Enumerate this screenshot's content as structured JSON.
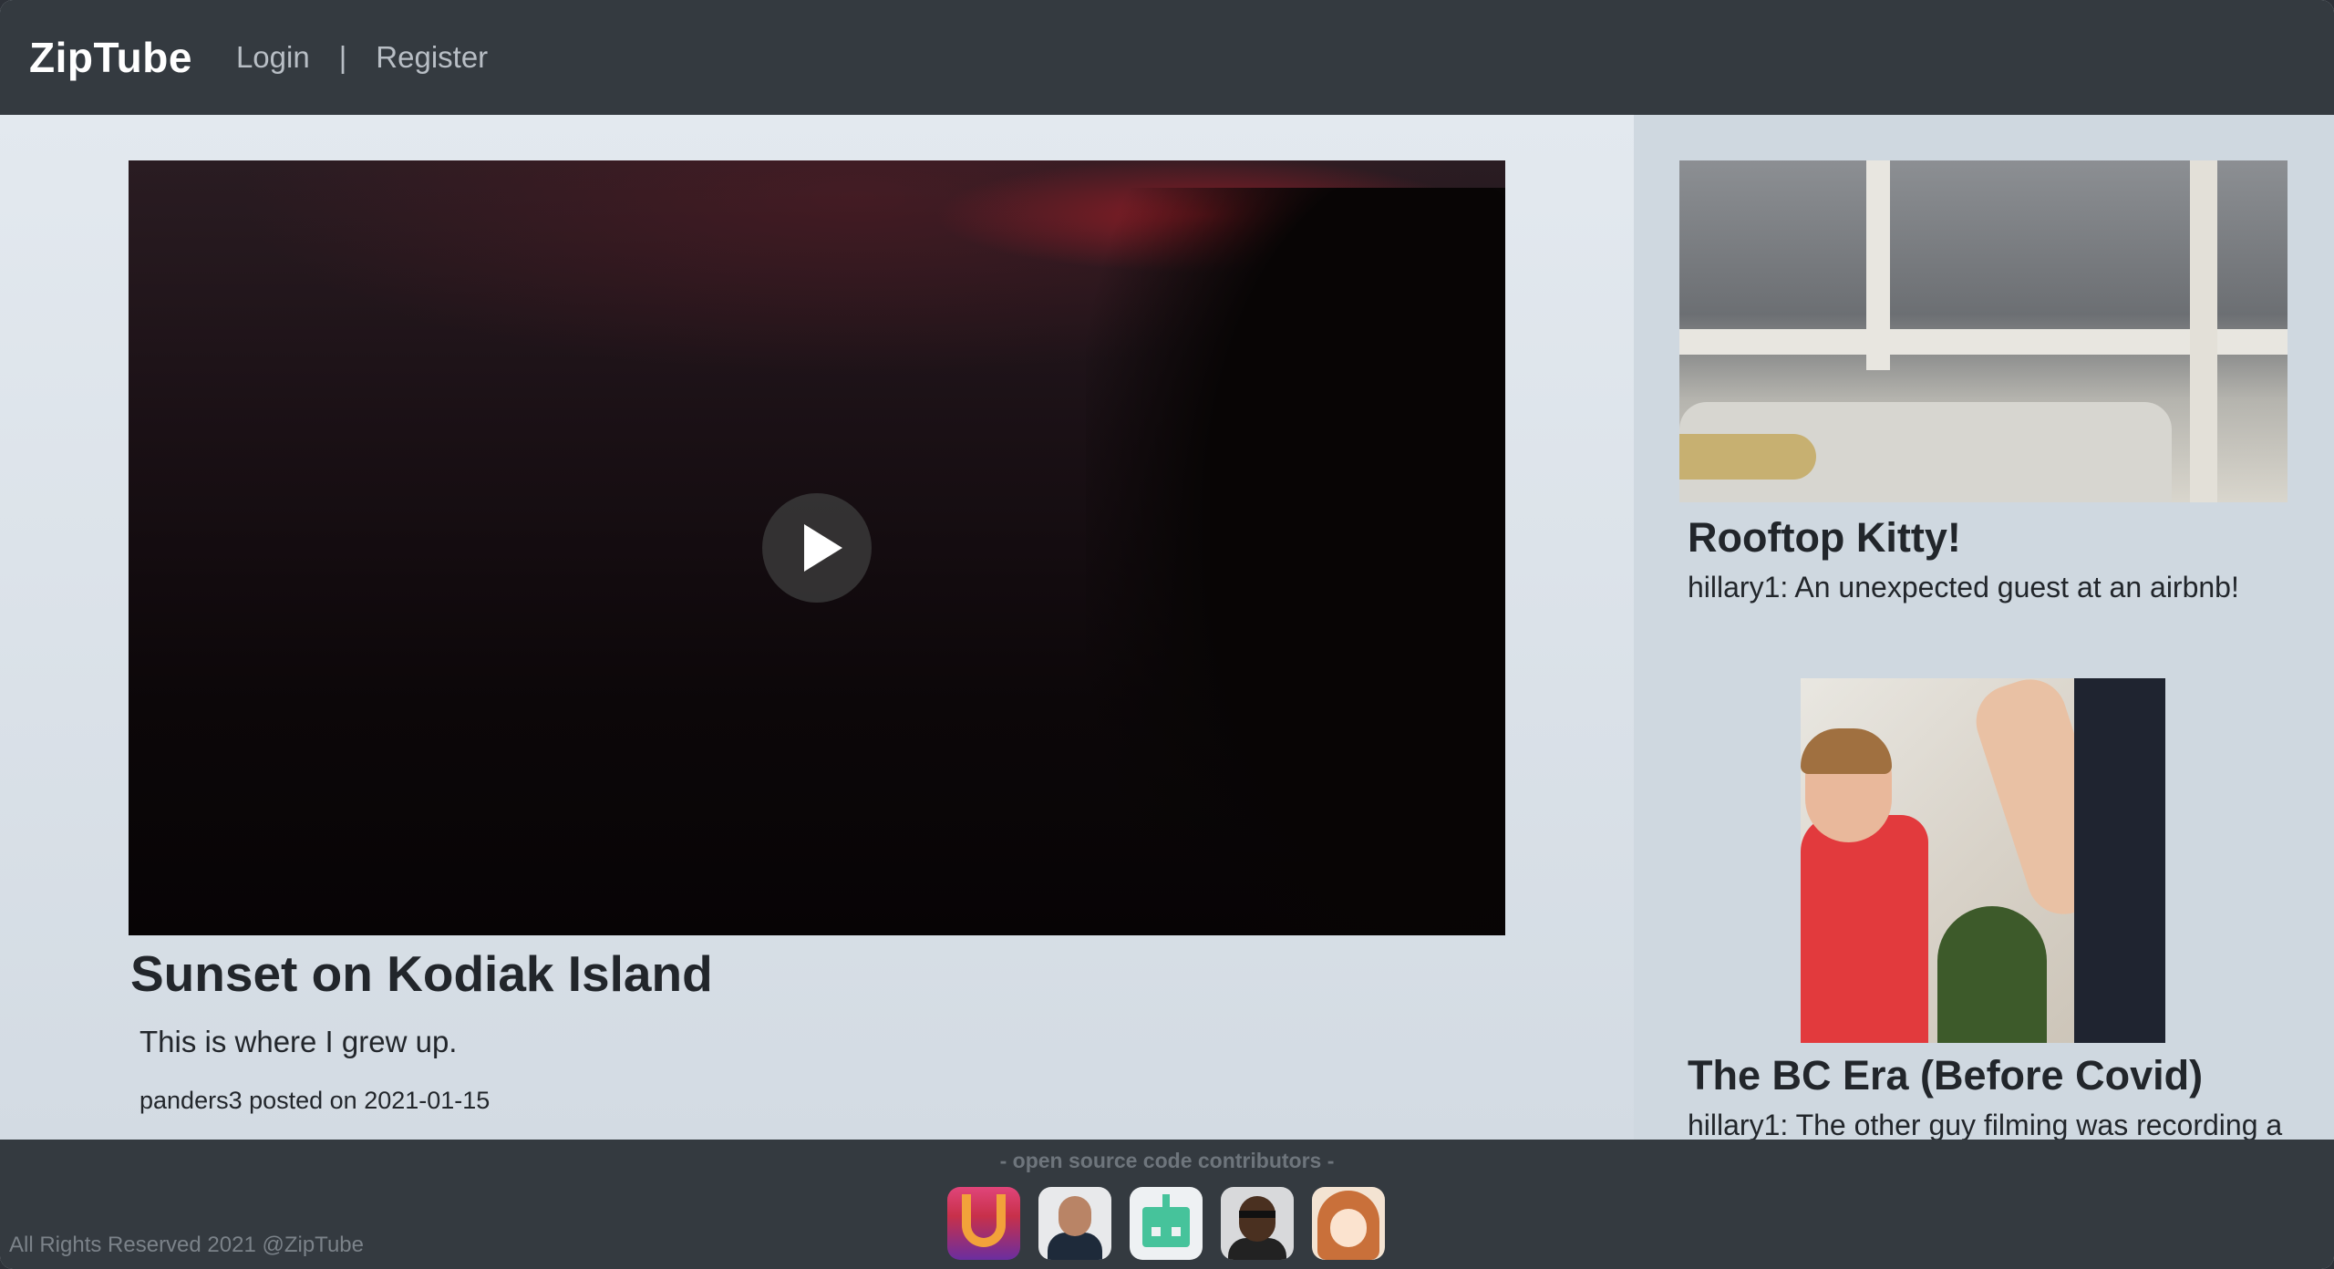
{
  "navbar": {
    "brand": "ZipTube",
    "login": "Login",
    "separator": "|",
    "register": "Register"
  },
  "video": {
    "title": "Sunset on Kodiak Island",
    "description": "This is where I grew up.",
    "meta": "panders3 posted on 2021-01-15",
    "play_icon": "play-icon"
  },
  "sidebar": {
    "items": [
      {
        "title": "Rooftop Kitty!",
        "description": "hillary1: An unexpected guest at an airbnb!"
      },
      {
        "title": "The BC Era (Before Covid)",
        "description": "hillary1: The other guy filming was recording a"
      }
    ]
  },
  "footer": {
    "contributors_label": "-  open source code contributors -",
    "copyright": "All Rights Reserved 2021 @ZipTube"
  },
  "colors": {
    "navbar_bg": "#343a40",
    "page_bg": "#dde4eb",
    "text_dark": "#22262b"
  }
}
